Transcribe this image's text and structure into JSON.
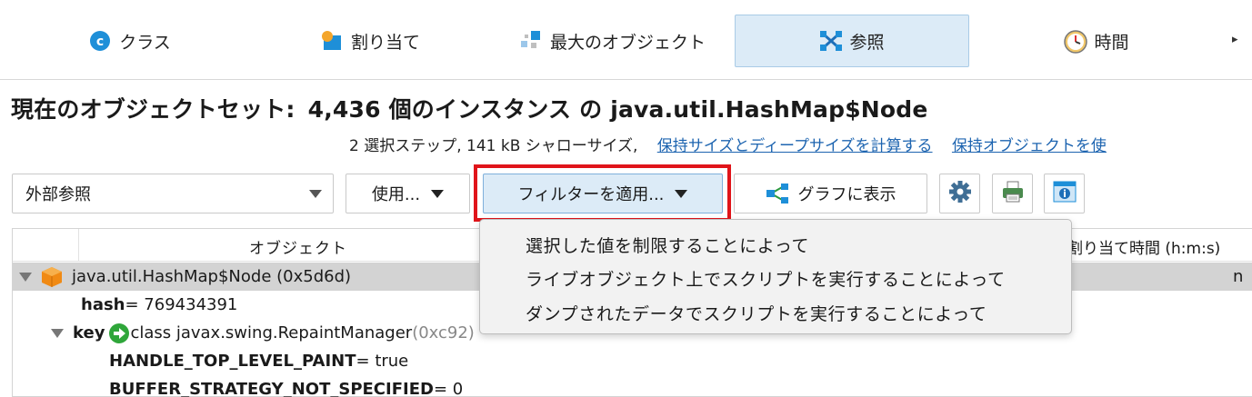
{
  "tabs": [
    {
      "label": "クラス",
      "icon": "class-c-icon"
    },
    {
      "label": "割り当て",
      "icon": "allocation-icon"
    },
    {
      "label": "最大のオブジェクト",
      "icon": "biggest-objects-icon"
    },
    {
      "label": "参照",
      "icon": "references-icon",
      "active": true
    },
    {
      "label": "時間",
      "icon": "clock-icon"
    }
  ],
  "tabs_more": "▸",
  "heading": {
    "prefix": "現在のオブジェクトセット:",
    "count_text": "4,436 個のインスタンス の java.util.HashMap$Node"
  },
  "subline": {
    "text": "2 選択ステップ, 141 kB シャローサイズ,",
    "link1": "保持サイズとディープサイズを計算する",
    "link2": "保持オブジェクトを使"
  },
  "toolbar": {
    "combo_value": "外部参照",
    "use_label": "使用...",
    "filter_label": "フィルターを適用...",
    "graph_label": "グラフに表示"
  },
  "table": {
    "col_object": "オブジェクト",
    "col_alloc": "割り当て時間 (h:m:s)",
    "rows": [
      {
        "name": "java.util.HashMap$Node (0x5d6d)",
        "end": "n"
      },
      {
        "field": "hash",
        "value": " = 769434391"
      },
      {
        "field": "key",
        "value": " class javax.swing.RepaintManager",
        "gray": " (0xc92)"
      },
      {
        "field": "HANDLE_TOP_LEVEL_PAINT",
        "value": " = true"
      },
      {
        "field": "BUFFER_STRATEGY_NOT_SPECIFIED",
        "value": " = 0"
      }
    ]
  },
  "popup": {
    "items": [
      "選択した値を制限することによって",
      "ライブオブジェクト上でスクリプトを実行することによって",
      "ダンプされたデータでスクリプトを実行することによって"
    ]
  },
  "colors": {
    "accent_blue": "#1d64b0",
    "active_tab_bg": "#dcebf7",
    "highlight_outline": "#e0141a",
    "selected_row": "#d3d3d3"
  }
}
